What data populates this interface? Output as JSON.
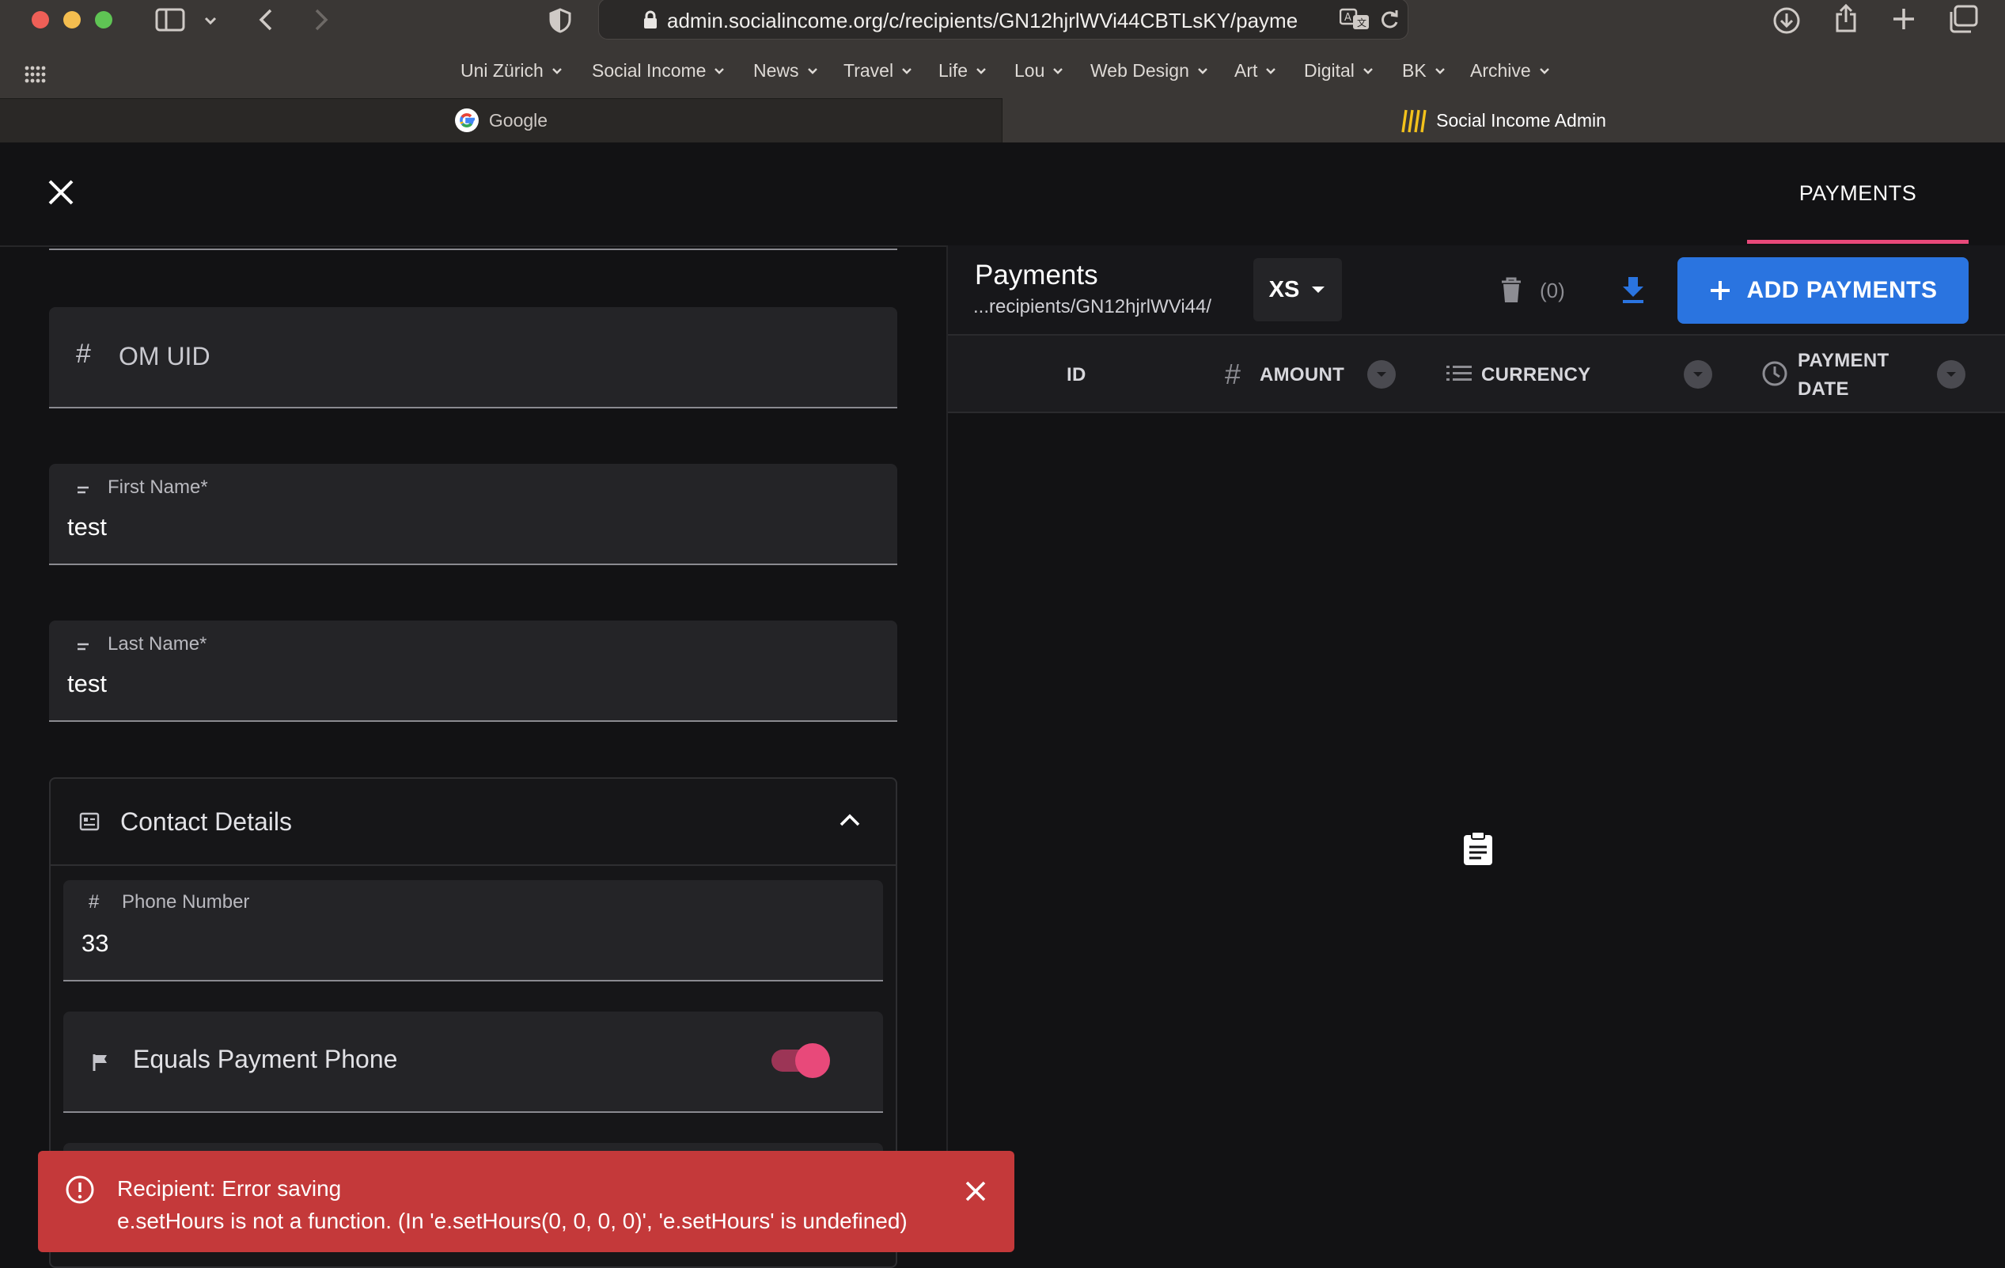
{
  "browser": {
    "url": "admin.socialincome.org/c/recipients/GN12hjrlWVi44CBTLsKY/payme",
    "bookmarks": [
      "Uni Zürich",
      "Social Income",
      "News",
      "Travel",
      "Life",
      "Lou",
      "Web Design",
      "Art",
      "Digital",
      "BK",
      "Archive"
    ],
    "tabs": [
      {
        "label": "Google",
        "active": false
      },
      {
        "label": "Social Income Admin",
        "active": true
      }
    ]
  },
  "app": {
    "side_tabs": {
      "payments": "PAYMENTS"
    },
    "form": {
      "om_uid": {
        "label": "OM UID"
      },
      "first_name": {
        "label": "First Name*",
        "value": "test"
      },
      "last_name": {
        "label": "Last Name*",
        "value": "test"
      },
      "contact_details": {
        "title": "Contact Details",
        "phone": {
          "label": "Phone Number",
          "value": "33"
        },
        "equals_payment_phone": {
          "label": "Equals Payment Phone",
          "checked": true
        }
      }
    },
    "payments": {
      "title": "Payments",
      "path": "...recipients/GN12hjrlWVi44/",
      "size": "XS",
      "delete_count": "(0)",
      "add_button": "ADD PAYMENTS",
      "columns": [
        "ID",
        "AMOUNT",
        "CURRENCY",
        "PAYMENT",
        "DATE"
      ]
    },
    "error": {
      "title": "Recipient: Error saving",
      "message": "e.setHours is not a function. (In 'e.setHours(0, 0, 0, 0)', 'e.setHours' is undefined)"
    }
  },
  "colors": {
    "accent": "#e8497a",
    "primary": "#2a74e0",
    "error": "#c4393a"
  }
}
